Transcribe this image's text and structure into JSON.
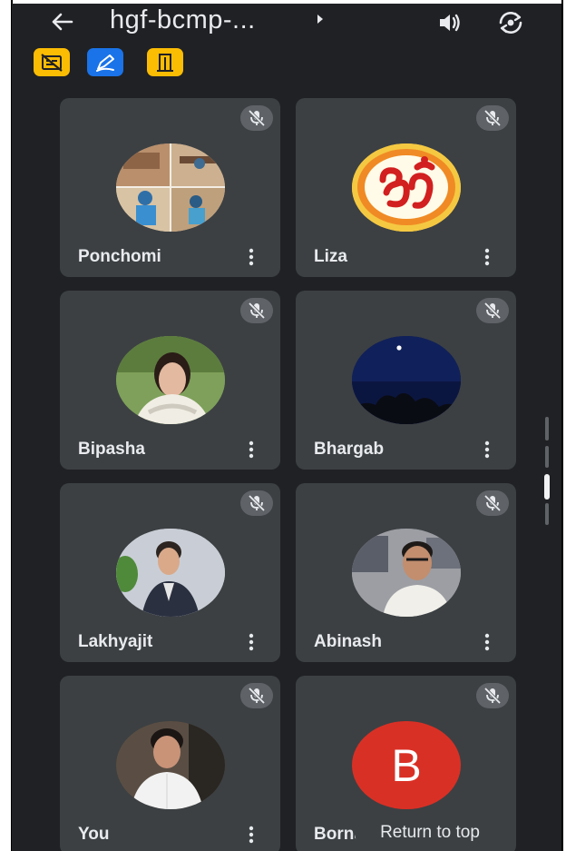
{
  "header": {
    "title": "hgf-bcmp-...",
    "icons": [
      "back-arrow-icon",
      "caret-right-icon",
      "speaker-icon",
      "camera-flip-icon"
    ]
  },
  "status_chips": [
    {
      "icon": "captions-off-icon",
      "color": "#fbbc04"
    },
    {
      "icon": "whiteboard-pen-icon",
      "color": "#1a73e8"
    },
    {
      "icon": "door-exit-icon",
      "color": "#fbbc04"
    }
  ],
  "participants": [
    {
      "name": "Ponchomi",
      "muted": true
    },
    {
      "name": "Liza",
      "muted": true
    },
    {
      "name": "Bipasha",
      "muted": true
    },
    {
      "name": "Bhargab",
      "muted": true
    },
    {
      "name": "Lakhyajit",
      "muted": true
    },
    {
      "name": "Abinash",
      "muted": true
    },
    {
      "name": "You",
      "muted": true
    },
    {
      "name": "Borna",
      "muted": true,
      "avatar_letter": "B",
      "avatar_color": "#d93025"
    }
  ],
  "return_to_top": "Return to top",
  "colors": {
    "background": "#202124",
    "tile": "#3c4043",
    "text": "#e8eaed"
  }
}
